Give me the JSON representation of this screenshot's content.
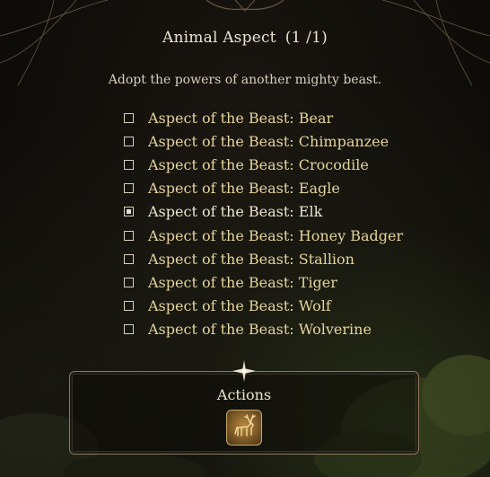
{
  "spell": {
    "title": "Animal Aspect",
    "count": "(1 /1)",
    "description": "Adopt the powers of another mighty beast."
  },
  "options": [
    {
      "label": "Aspect of the Beast: Bear",
      "checked": false
    },
    {
      "label": "Aspect of the Beast: Chimpanzee",
      "checked": false
    },
    {
      "label": "Aspect of the Beast: Crocodile",
      "checked": false
    },
    {
      "label": "Aspect of the Beast: Eagle",
      "checked": false
    },
    {
      "label": "Aspect of the Beast: Elk",
      "checked": true
    },
    {
      "label": "Aspect of the Beast: Honey Badger",
      "checked": false
    },
    {
      "label": "Aspect of the Beast: Stallion",
      "checked": false
    },
    {
      "label": "Aspect of the Beast: Tiger",
      "checked": false
    },
    {
      "label": "Aspect of the Beast: Wolf",
      "checked": false
    },
    {
      "label": "Aspect of the Beast: Wolverine",
      "checked": false
    }
  ],
  "actions": {
    "title": "Actions",
    "icon": "elk-icon"
  },
  "colors": {
    "option_text": "#e3d39d",
    "title_text": "#ece4d2",
    "frame": "#8c7a5c",
    "icon_gold": "#b8893e"
  }
}
